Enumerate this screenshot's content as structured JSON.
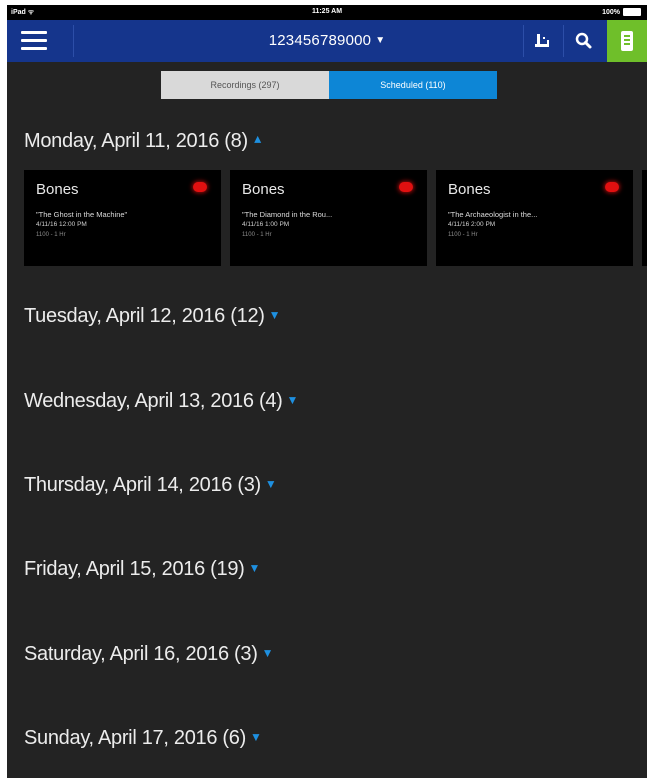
{
  "status_bar": {
    "left": "iPad ᯤ",
    "time": "11:25 AM",
    "battery": "100%"
  },
  "header": {
    "account": "123456789000"
  },
  "tabs": [
    {
      "label": "Recordings (297)"
    },
    {
      "label": "Scheduled (110)"
    }
  ],
  "days": [
    {
      "label": "Monday, April 11, 2016 (8)",
      "expanded": true,
      "cards": [
        {
          "title": "Bones",
          "episode": "\"The Ghost in the Machine\"",
          "datetime": "4/11/16 12:00 PM",
          "channel": "1100 - 1 Hr"
        },
        {
          "title": "Bones",
          "episode": "\"The Diamond in the Rou...",
          "datetime": "4/11/16 1:00 PM",
          "channel": "1100 - 1 Hr"
        },
        {
          "title": "Bones",
          "episode": "\"The Archaeologist in the...",
          "datetime": "4/11/16 2:00 PM",
          "channel": "1100 - 1 Hr"
        }
      ]
    },
    {
      "label": "Tuesday, April 12, 2016 (12)",
      "expanded": false
    },
    {
      "label": "Wednesday, April 13, 2016 (4)",
      "expanded": false
    },
    {
      "label": "Thursday, April 14, 2016 (3)",
      "expanded": false
    },
    {
      "label": "Friday, April 15, 2016 (19)",
      "expanded": false
    },
    {
      "label": "Saturday, April 16, 2016 (3)",
      "expanded": false
    },
    {
      "label": "Sunday, April 17, 2016 (6)",
      "expanded": false
    }
  ],
  "colors": {
    "nav": "#15358c",
    "accent": "#0d86d6",
    "remote": "#6fbf2a",
    "record": "#e01010",
    "background": "#232323"
  },
  "icons": [
    "menu-icon",
    "chevron-down-icon",
    "filter-sort-icon",
    "search-icon",
    "remote-icon",
    "record-indicator-icon",
    "chevron-up-icon"
  ]
}
